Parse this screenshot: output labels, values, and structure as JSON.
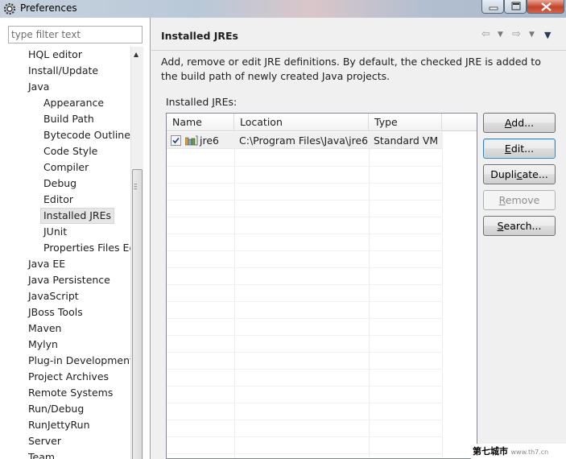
{
  "window": {
    "title": "Preferences",
    "icon": "eclipse-gear-icon"
  },
  "filter": {
    "placeholder": "type filter text"
  },
  "tree": {
    "items": [
      {
        "label": "HQL editor",
        "level": 1
      },
      {
        "label": "Install/Update",
        "level": 1
      },
      {
        "label": "Java",
        "level": 1
      },
      {
        "label": "Appearance",
        "level": 2
      },
      {
        "label": "Build Path",
        "level": 2
      },
      {
        "label": "Bytecode Outline",
        "level": 2
      },
      {
        "label": "Code Style",
        "level": 2
      },
      {
        "label": "Compiler",
        "level": 2
      },
      {
        "label": "Debug",
        "level": 2
      },
      {
        "label": "Editor",
        "level": 2
      },
      {
        "label": "Installed JREs",
        "level": 2,
        "selected": true
      },
      {
        "label": "JUnit",
        "level": 2
      },
      {
        "label": "Properties Files Ed",
        "level": 2
      },
      {
        "label": "Java EE",
        "level": 1
      },
      {
        "label": "Java Persistence",
        "level": 1
      },
      {
        "label": "JavaScript",
        "level": 1
      },
      {
        "label": "JBoss Tools",
        "level": 1
      },
      {
        "label": "Maven",
        "level": 1
      },
      {
        "label": "Mylyn",
        "level": 1
      },
      {
        "label": "Plug-in Development",
        "level": 1
      },
      {
        "label": "Project Archives",
        "level": 1
      },
      {
        "label": "Remote Systems",
        "level": 1
      },
      {
        "label": "Run/Debug",
        "level": 1
      },
      {
        "label": "RunJettyRun",
        "level": 1
      },
      {
        "label": "Server",
        "level": 1
      },
      {
        "label": "Team",
        "level": 1
      }
    ]
  },
  "page": {
    "title": "Installed JREs",
    "description": "Add, remove or edit JRE definitions. By default, the checked JRE is added to the build path of newly created Java projects.",
    "table_label_pre": "Installed ",
    "table_label_mnemonic": "J",
    "table_label_post": "REs:"
  },
  "table": {
    "columns": [
      "Name",
      "Location",
      "Type"
    ],
    "rows": [
      {
        "checked": true,
        "name": "jre6",
        "location": "C:\\Program Files\\Java\\jre6",
        "type": "Standard VM"
      }
    ]
  },
  "buttons": {
    "add": {
      "mnemonic": "A",
      "rest": "dd..."
    },
    "edit": {
      "mnemonic": "E",
      "rest": "dit..."
    },
    "duplicate": {
      "pre": "Dupli",
      "mnemonic": "c",
      "rest": "ate..."
    },
    "remove": {
      "mnemonic": "R",
      "rest": "emove"
    },
    "search": {
      "mnemonic": "S",
      "rest": "earch..."
    }
  },
  "watermark": {
    "site": "第七城市",
    "url": "www.th7.cn"
  }
}
